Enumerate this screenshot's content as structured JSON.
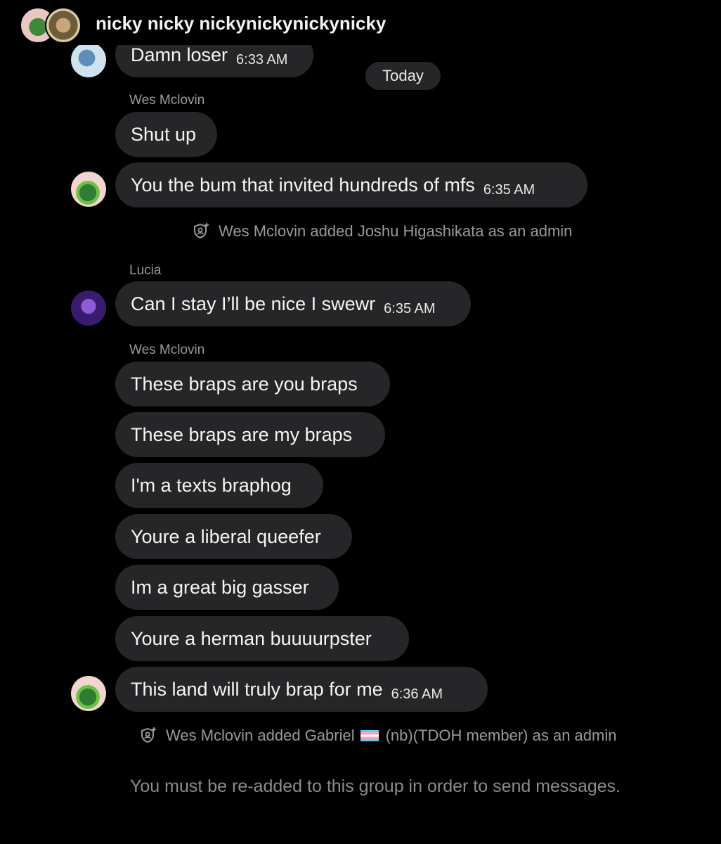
{
  "header": {
    "title": "nicky nicky nickynickynickynicky",
    "avatar_icons": [
      "group-avatar-1",
      "group-avatar-2"
    ]
  },
  "divider": {
    "label": "Today"
  },
  "messages": [
    {
      "text": "Damn loser",
      "time": "6:33 AM"
    },
    {
      "sender": "Wes Mclovin"
    },
    {
      "text": "Shut up"
    },
    {
      "text": "You the bum that invited hundreds of mfs",
      "time": "6:35 AM"
    },
    {
      "system": "Wes Mclovin added Joshu Higashikata as an admin"
    },
    {
      "sender": "Lucia"
    },
    {
      "text": "Can I stay I’ll be nice I swewr",
      "time": "6:35 AM"
    },
    {
      "sender": "Wes Mclovin"
    },
    {
      "text": "These braps are you braps"
    },
    {
      "text": "These braps are my braps"
    },
    {
      "text": "I'm a texts braphog"
    },
    {
      "text": "Youre a liberal queefer"
    },
    {
      "text": "Im a great big gasser"
    },
    {
      "text": "Youre a herman buuuurpster"
    },
    {
      "text": "This land will truly brap for me",
      "time": "6:36 AM"
    },
    {
      "system_before": "Wes Mclovin added Gabriel",
      "system_after": "(nb)(TDOH member) as an admin"
    }
  ],
  "footer": {
    "note": "You must be re-added to this group in order to send messages."
  },
  "colors": {
    "background": "#000000",
    "bubble": "#262628",
    "muted_text": "#9a9a9e"
  }
}
